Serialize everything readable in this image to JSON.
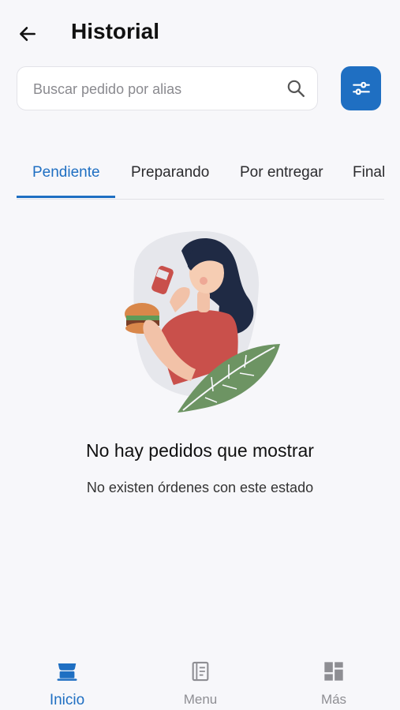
{
  "header": {
    "title": "Historial"
  },
  "search": {
    "placeholder": "Buscar pedido por alias"
  },
  "tabs": [
    {
      "label": "Pendiente",
      "active": true
    },
    {
      "label": "Preparando"
    },
    {
      "label": "Por entregar"
    },
    {
      "label": "Finali"
    }
  ],
  "empty_state": {
    "title": "No hay pedidos que mostrar",
    "subtitle": "No existen órdenes con este estado"
  },
  "bottom_nav": [
    {
      "label": "Inicio",
      "icon": "store-icon",
      "active": true
    },
    {
      "label": "Menu",
      "icon": "book-icon"
    },
    {
      "label": "Más",
      "icon": "grid-icon"
    }
  ],
  "colors": {
    "accent": "#1f6fc2",
    "background": "#f7f7fa",
    "inactive": "#8e8e93"
  }
}
